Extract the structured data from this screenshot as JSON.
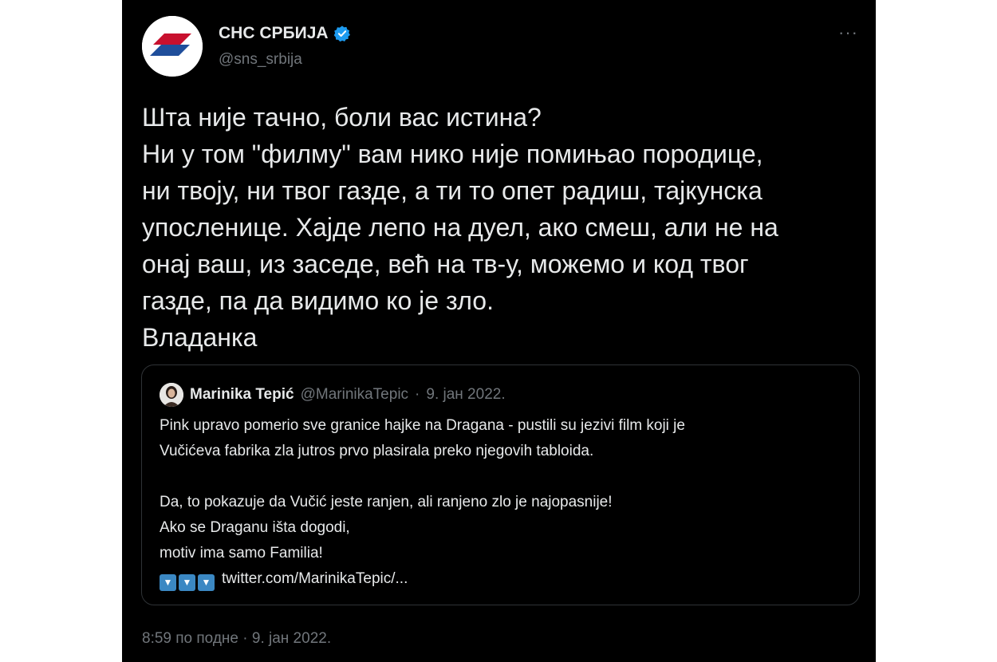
{
  "author": {
    "name": "СНС СРБИЈА",
    "handle": "@sns_srbija",
    "verified": true,
    "avatar_colors": [
      "#c8102e",
      "#1f4e9b",
      "#ffffff"
    ]
  },
  "more_icon": "more-horizontal-icon",
  "tweet": {
    "lines": [
      "Шта није тачно, боли вас истина?",
      "Ни у том \"филму\" вам нико није помињао породице,",
      "ни твоју, ни твог газде, а ти то опет радиш, тајкунска",
      "упосленице. Хајде лепо на дуел, ако смеш, али не на",
      "онај ваш, из заседе, већ на тв-у, можемо и код твог",
      "газде, па да видимо ко је зло.",
      "Владанка"
    ]
  },
  "quoted_tweet": {
    "name": "Marinika Tepić",
    "handle": "@MarinikaTepic",
    "separator": "·",
    "date": "9. јан 2022.",
    "lines": [
      "Pink upravo pomerio sve granice hajke na Dragana - pustili su jezivi film koji je",
      "Vučićeva fabrika zla jutros prvo plasirala preko njegovih tabloida.",
      "",
      "Da, to pokazuje da Vučić jeste ranjen, ali ranjeno zlo je najopasnije!",
      "Ako se Draganu išta dogodi,",
      "motiv ima samo Familia!"
    ],
    "arrow_emoji": "▼",
    "link_text": "twitter.com/MarinikaTepic/..."
  },
  "timestamp": {
    "time": "8:59 по подне",
    "separator": "·",
    "date": "9. јан 2022."
  },
  "colors": {
    "background": "#000000",
    "text": "#e7e9ea",
    "secondary_text": "#71767b",
    "verified_badge": "#1d9bf0",
    "border": "#2f3336"
  }
}
